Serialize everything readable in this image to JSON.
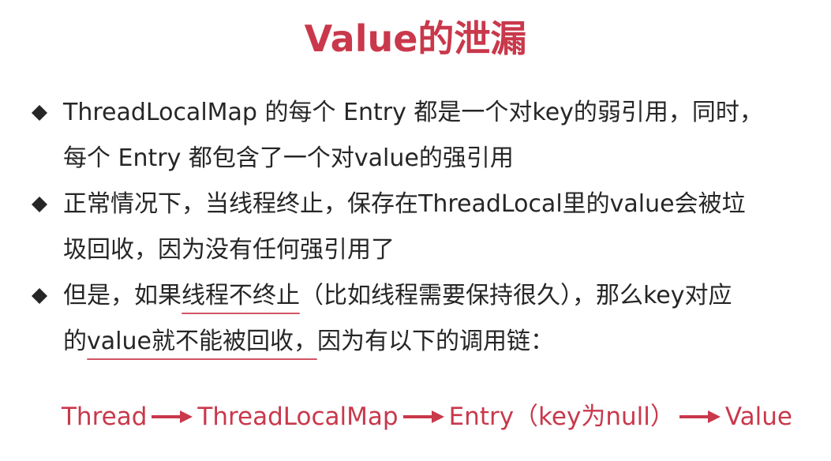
{
  "slide": {
    "title": "Value的泄漏",
    "accent_color": "#c9384b",
    "bullets": [
      {
        "lines": [
          "ThreadLocalMap 的每个 Entry 都是一个对key的弱引用，同时，",
          "每个 Entry 都包含了一个对value的强引用"
        ]
      },
      {
        "lines": [
          "正常情况下，当线程终止，保存在ThreadLocal里的value会被垃",
          "圾回收，因为没有任何强引用了"
        ]
      },
      {
        "line1_pre": "但是，如果",
        "line1_underlined": "线程不终止",
        "line1_post": "（比如线程需要保持很久），那么key对应",
        "line2_pre": "的",
        "line2_underlined": "value就不能被回收，",
        "line2_post": "因为有以下的调用链："
      }
    ],
    "bullet_icon": "diamond-icon",
    "chain": {
      "nodes": [
        "Thread",
        "ThreadLocalMap",
        "Entry（key为null）",
        "Value"
      ],
      "arrow_icon": "right-arrow-icon"
    }
  }
}
